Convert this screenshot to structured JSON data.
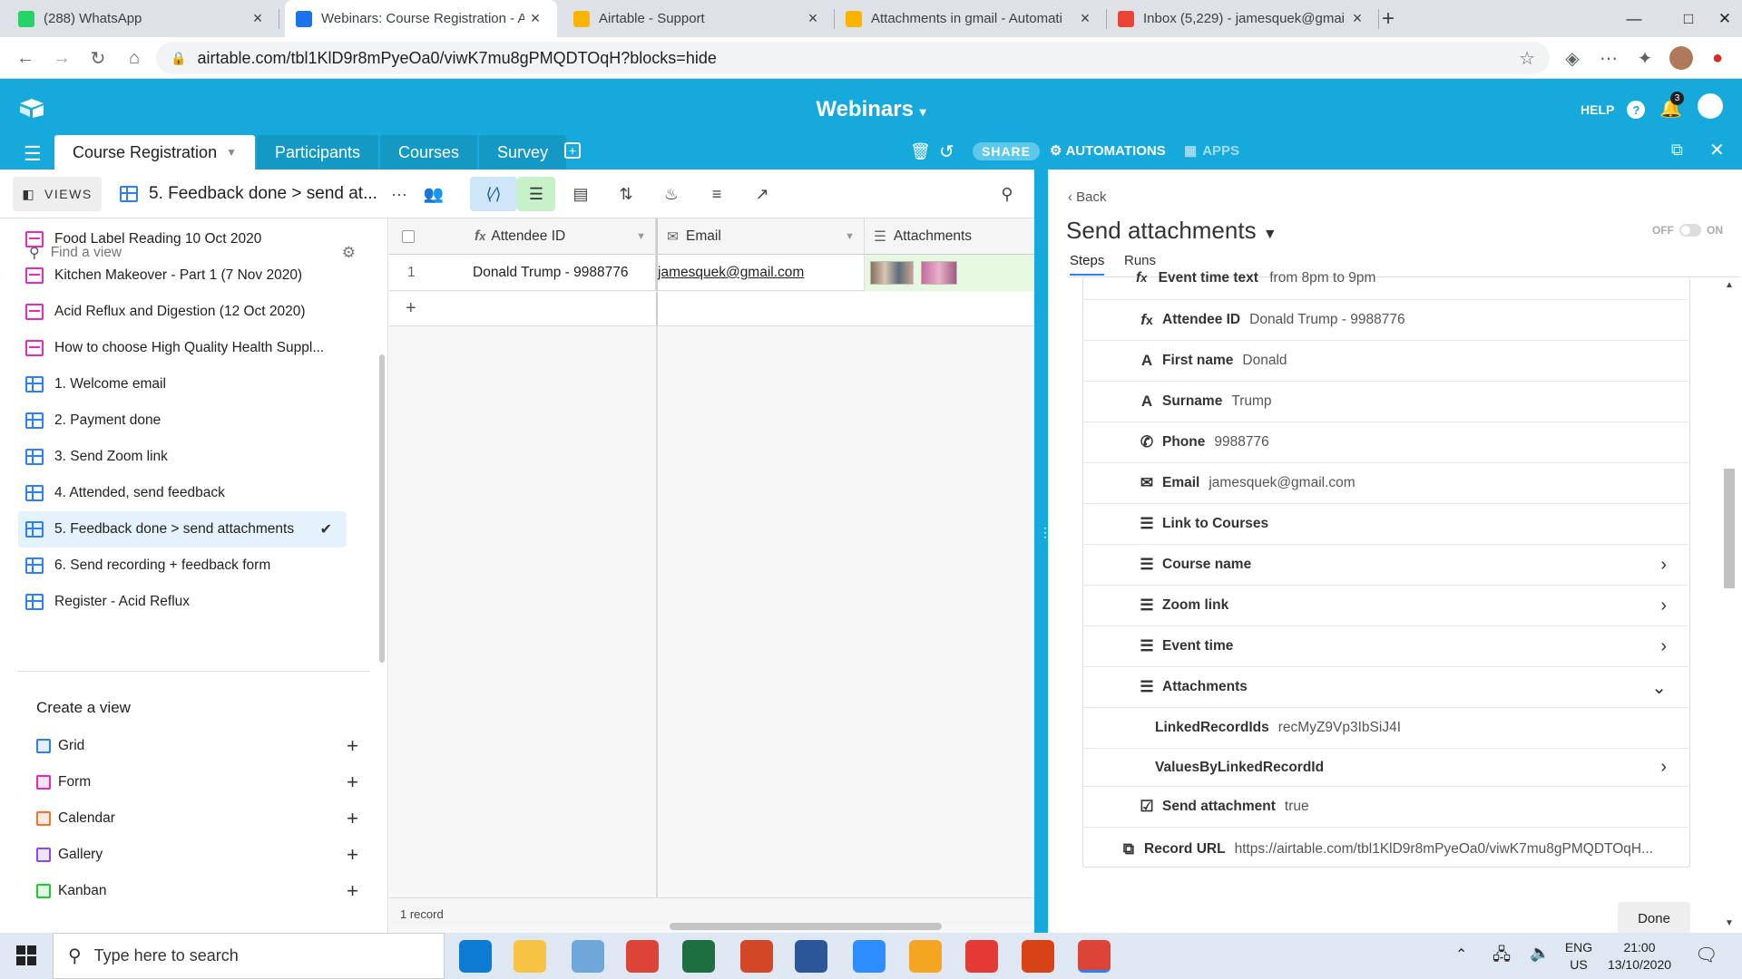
{
  "browser": {
    "tabs": [
      {
        "title": "(288) WhatsApp",
        "icon": "whatsapp-icon",
        "color": "#25d366",
        "active": false
      },
      {
        "title": "Webinars: Course Registration - A",
        "icon": "airtable-we-icon",
        "color": "#1a73e8",
        "active": true
      },
      {
        "title": "Airtable - Support",
        "icon": "airtable-icon",
        "color": "#fcb400",
        "active": false
      },
      {
        "title": "Attachments in gmail - Automati",
        "icon": "airtable-icon",
        "color": "#fcb400",
        "active": false
      },
      {
        "title": "Inbox (5,229) - jamesquek@gmai",
        "icon": "gmail-icon",
        "color": "#ea4335",
        "active": false
      }
    ],
    "url": "airtable.com/tbl1KlD9r8mPyeOa0/viwK7mu8gPMQDTOqH?blocks=hide"
  },
  "airtable": {
    "base_title": "Webinars",
    "help_label": "HELP",
    "notification_count": "3",
    "tables": [
      "Course Registration",
      "Participants",
      "Courses",
      "Survey"
    ],
    "share_label": "SHARE",
    "automations_label": "AUTOMATIONS",
    "apps_label": "APPS"
  },
  "viewbar": {
    "views_label": "VIEWS",
    "current_view": "5. Feedback done > send at...",
    "more_label": "···"
  },
  "sidebar": {
    "search_placeholder": "Find a view",
    "views": [
      {
        "label": "Food Label Reading 10 Oct 2020",
        "type": "form",
        "color": "#e929ba"
      },
      {
        "label": "Kitchen Makeover - Part 1 (7 Nov 2020)",
        "type": "form",
        "color": "#e929ba"
      },
      {
        "label": "Acid Reflux and Digestion (12 Oct 2020)",
        "type": "form",
        "color": "#e929ba"
      },
      {
        "label": "How to choose High Quality Health Suppl...",
        "type": "form",
        "color": "#e929ba"
      },
      {
        "label": "1. Welcome email",
        "type": "grid",
        "color": "#2d7ff9"
      },
      {
        "label": "2. Payment done",
        "type": "grid",
        "color": "#2d7ff9"
      },
      {
        "label": "3. Send Zoom link",
        "type": "grid",
        "color": "#2d7ff9"
      },
      {
        "label": "4. Attended, send feedback",
        "type": "grid",
        "color": "#2d7ff9"
      },
      {
        "label": "5. Feedback done > send attachments",
        "type": "grid",
        "color": "#2d7ff9",
        "selected": true
      },
      {
        "label": "6. Send recording + feedback form",
        "type": "grid",
        "color": "#2d7ff9"
      },
      {
        "label": "Register - Acid Reflux",
        "type": "grid",
        "color": "#2d7ff9"
      }
    ],
    "create_title": "Create a view",
    "create_items": [
      {
        "label": "Grid",
        "color": "#2d7ff9"
      },
      {
        "label": "Form",
        "color": "#e929ba"
      },
      {
        "label": "Calendar",
        "color": "#ff6f2c"
      },
      {
        "label": "Gallery",
        "color": "#8b46ff"
      },
      {
        "label": "Kanban",
        "color": "#20c933"
      }
    ]
  },
  "grid": {
    "columns": [
      "Attendee ID",
      "Email",
      "Attachments"
    ],
    "rows": [
      {
        "num": "1",
        "attendee_id": "Donald Trump - 9988776",
        "email": "jamesquek@gmail.com"
      }
    ],
    "add_row": "+",
    "record_count": "1 record"
  },
  "panel": {
    "back_label": "Back",
    "title": "Send attachments",
    "toggle_off": "OFF",
    "toggle_on": "ON",
    "tabs": [
      "Steps",
      "Runs"
    ],
    "partial_row": {
      "label": "Event time text",
      "value": "from 8pm to 9pm"
    },
    "rows": [
      {
        "icon": "formula-icon",
        "glyph": "fx",
        "label": "Attendee ID",
        "value": "Donald Trump - 9988776",
        "indent": false,
        "chevron": ""
      },
      {
        "icon": "text-icon",
        "glyph": "A",
        "label": "First name",
        "value": "Donald",
        "indent": false,
        "chevron": ""
      },
      {
        "icon": "text-icon",
        "glyph": "A",
        "label": "Surname",
        "value": "Trump",
        "indent": false,
        "chevron": ""
      },
      {
        "icon": "phone-icon",
        "glyph": "✆",
        "label": "Phone",
        "value": "9988776",
        "indent": false,
        "chevron": ""
      },
      {
        "icon": "email-icon",
        "glyph": "✉",
        "label": "Email",
        "value": "jamesquek@gmail.com",
        "indent": false,
        "chevron": ""
      },
      {
        "icon": "link-icon",
        "glyph": "☰",
        "label": "Link to Courses",
        "value": "",
        "indent": false,
        "chevron": ""
      },
      {
        "icon": "lookup-icon",
        "glyph": "☰",
        "label": "Course name",
        "value": "",
        "indent": false,
        "chevron": "›"
      },
      {
        "icon": "lookup-icon",
        "glyph": "☰",
        "label": "Zoom link",
        "value": "",
        "indent": false,
        "chevron": "›"
      },
      {
        "icon": "lookup-icon",
        "glyph": "☰",
        "label": "Event time",
        "value": "",
        "indent": false,
        "chevron": "›"
      },
      {
        "icon": "lookup-icon",
        "glyph": "☰",
        "label": "Attachments",
        "value": "",
        "indent": false,
        "chevron": "⌄"
      },
      {
        "icon": "",
        "glyph": "",
        "label": "LinkedRecordIds",
        "value": "recMyZ9Vp3IbSiJ4I",
        "indent": true,
        "chevron": ""
      },
      {
        "icon": "",
        "glyph": "",
        "label": "ValuesByLinkedRecordId",
        "value": "",
        "indent": true,
        "chevron": "›"
      },
      {
        "icon": "checkbox-icon",
        "glyph": "☑",
        "label": "Send attachment",
        "value": "true",
        "indent": false,
        "chevron": ""
      },
      {
        "icon": "record-url-icon",
        "glyph": "⧉",
        "label": "Record URL",
        "value": "https://airtable.com/tbl1KlD9r8mPyeOa0/viwK7mu8gPMQDTOqH...",
        "indent": false,
        "chevron": "",
        "outdent": true
      }
    ],
    "done_label": "Done"
  },
  "taskbar": {
    "search_placeholder": "Type here to search",
    "lang_top": "ENG",
    "lang_bottom": "US",
    "time": "21:00",
    "date": "13/10/2020",
    "apps": [
      {
        "name": "edge-icon",
        "color": "#0c7bd4"
      },
      {
        "name": "file-explorer-icon",
        "color": "#f6c342"
      },
      {
        "name": "paint-icon",
        "color": "#6ea7d9"
      },
      {
        "name": "chrome-icon",
        "color": "#db4437"
      },
      {
        "name": "excel-icon",
        "color": "#1d6f42"
      },
      {
        "name": "powerpoint-icon",
        "color": "#d24726"
      },
      {
        "name": "word-icon",
        "color": "#2b579a"
      },
      {
        "name": "zoom-icon",
        "color": "#2d8cff"
      },
      {
        "name": "feedback-app-icon",
        "color": "#f4a623"
      },
      {
        "name": "snip-icon",
        "color": "#e53935"
      },
      {
        "name": "pen-icon",
        "color": "#d84315"
      },
      {
        "name": "chrome-profile-icon",
        "color": "#db4437"
      }
    ]
  }
}
